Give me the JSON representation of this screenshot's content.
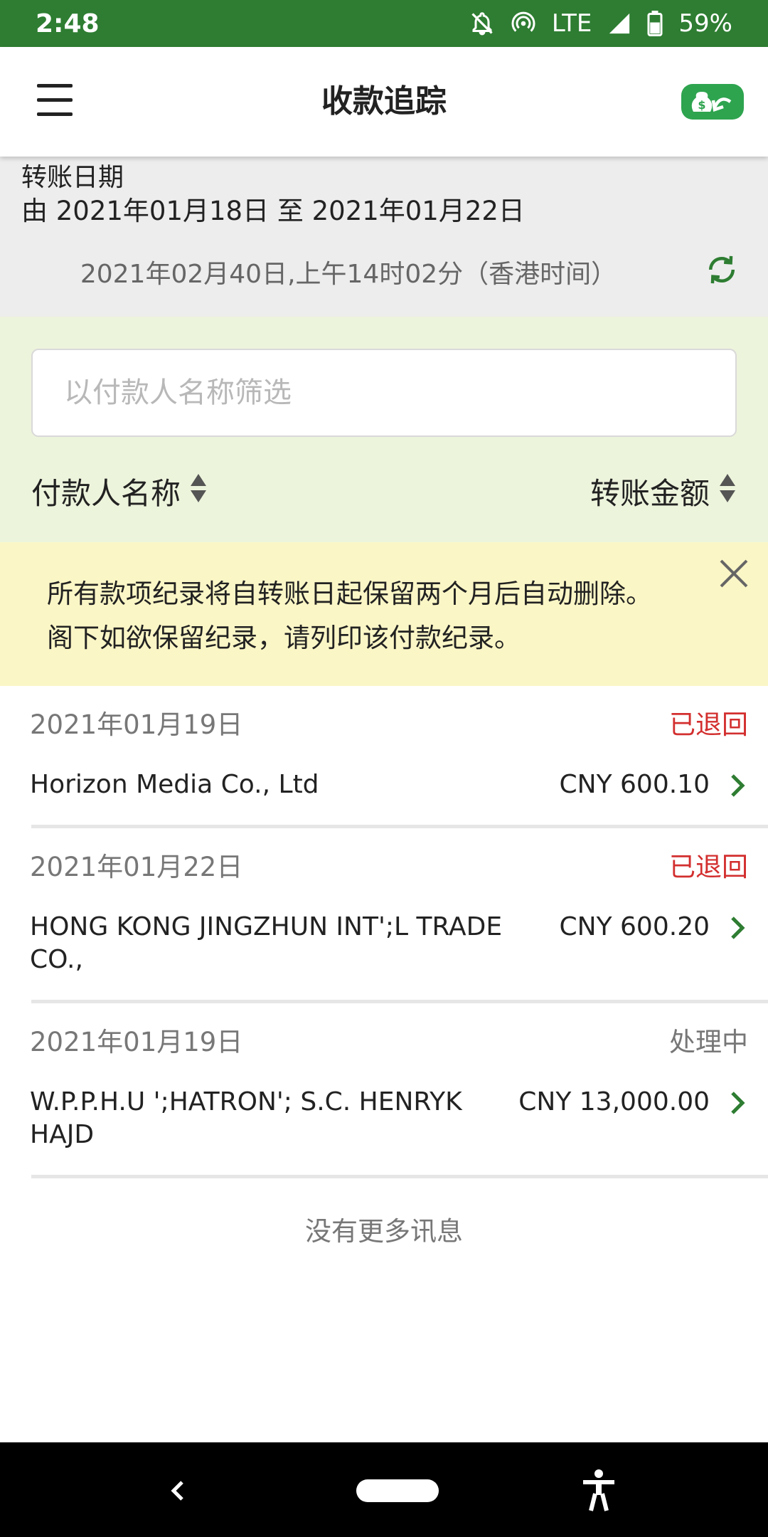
{
  "status_bar": {
    "time": "2:48",
    "network": "LTE",
    "battery": "59%"
  },
  "header": {
    "title": "收款追踪",
    "menu_icon": "hamburger-menu-icon",
    "action_icon": "money-bag-return-icon"
  },
  "date_section": {
    "label": "转账日期",
    "range": "由 2021年01月18日 至 2021年01月22日",
    "updated": "2021年02月40日,上午14时02分（香港时间）",
    "refresh_icon": "refresh-icon"
  },
  "filter": {
    "placeholder": "以付款人名称筛选",
    "sort_payer_label": "付款人名称",
    "sort_amount_label": "转账金额"
  },
  "notice": {
    "line1": "所有款项纪录将自转账日起保留两个月后自动删除。",
    "line2": "阁下如欲保留纪录，请列印该付款纪录。"
  },
  "records": [
    {
      "date": "2021年01月19日",
      "status": "已退回",
      "status_color": "#d32f2f",
      "payer": "Horizon Media Co., Ltd",
      "amount": "CNY 600.10"
    },
    {
      "date": "2021年01月22日",
      "status": "已退回",
      "status_color": "#d32f2f",
      "payer": "HONG KONG JINGZHUN INT';L TRADE CO.,",
      "amount": "CNY 600.20"
    },
    {
      "date": "2021年01月19日",
      "status": "处理中",
      "status_color": "#777777",
      "payer": "W.P.P.H.U ';HATRON'; S.C. HENRYK HAJD",
      "amount": "CNY 13,000.00"
    }
  ],
  "list_end_text": "没有更多讯息",
  "colors": {
    "brand_green": "#2e7d32",
    "accent_green": "#2ea44f",
    "filter_bg": "#edf4dc",
    "notice_bg": "#fbf6c6"
  }
}
